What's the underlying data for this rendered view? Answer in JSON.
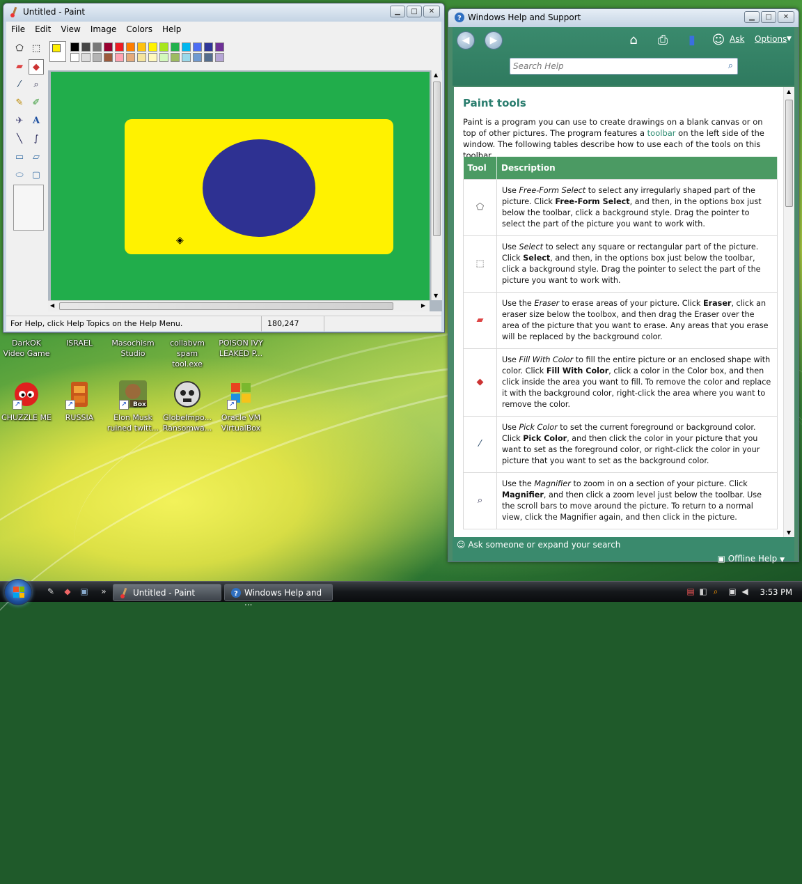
{
  "paint": {
    "title": "Untitled - Paint",
    "menu": [
      "File",
      "Edit",
      "View",
      "Image",
      "Colors",
      "Help"
    ],
    "status_text": "For Help, click Help Topics on the Help Menu.",
    "coordinates": "180,247",
    "foreground_color": "#ffef00",
    "background_color": "#ffffff",
    "palette_top": [
      "#000000",
      "#464646",
      "#787878",
      "#990030",
      "#ed1c24",
      "#ff7e00",
      "#ffc20e",
      "#fff200",
      "#a8e61d",
      "#22b14c",
      "#00b7ef",
      "#4d6df3",
      "#2f3699",
      "#6f3198"
    ],
    "palette_bottom": [
      "#ffffff",
      "#dcdcdc",
      "#b4b4b4",
      "#9c5a3c",
      "#ffa3b1",
      "#e5aa7a",
      "#f5e49c",
      "#fff9bd",
      "#d3f9bc",
      "#9dbb61",
      "#99d9ea",
      "#709ad1",
      "#546d8e",
      "#b5a5d5"
    ],
    "tools": [
      {
        "name": "free-form-select",
        "glyph": "⬠"
      },
      {
        "name": "select",
        "glyph": "⬚"
      },
      {
        "name": "eraser",
        "glyph": "▰"
      },
      {
        "name": "fill-with-color",
        "glyph": "◆"
      },
      {
        "name": "pick-color",
        "glyph": "⁄"
      },
      {
        "name": "magnifier",
        "glyph": "⌕"
      },
      {
        "name": "pencil",
        "glyph": "✎"
      },
      {
        "name": "brush",
        "glyph": "✐"
      },
      {
        "name": "airbrush",
        "glyph": "✈"
      },
      {
        "name": "text",
        "glyph": "A"
      },
      {
        "name": "line",
        "glyph": "╲"
      },
      {
        "name": "curve",
        "glyph": "∫"
      },
      {
        "name": "rectangle",
        "glyph": "▭"
      },
      {
        "name": "polygon",
        "glyph": "▱"
      },
      {
        "name": "ellipse",
        "glyph": "⬭"
      },
      {
        "name": "rounded-rectangle",
        "glyph": "▢"
      }
    ],
    "canvas_colors": {
      "background": "#21ad4b",
      "rectangle": "#fff200",
      "ellipse": "#2e3192"
    }
  },
  "desktop_icons": [
    {
      "label": "DarkOK Video Game"
    },
    {
      "label": "ISRAEL"
    },
    {
      "label": "Masochism Studio"
    },
    {
      "label": "collabvm spam tool.exe"
    },
    {
      "label": "POISON IVY LEAKED P..."
    },
    {
      "label": "CHUZZLE ME"
    },
    {
      "label": "RUSSIA"
    },
    {
      "label": "Elon Musk ruined twitt..."
    },
    {
      "label": "GlobeImpo... Ransomwa..."
    },
    {
      "label": "Oracle VM VirtualBox"
    }
  ],
  "help": {
    "title": "Windows Help and Support",
    "ask_label": "Ask",
    "options_label": "Options",
    "search_placeholder": "Search Help",
    "page_title": "Paint tools",
    "intro_1": "Paint is a program you can use to create drawings on a blank canvas or on top of other pictures. The program features a ",
    "intro_link": "toolbar",
    "intro_2": " on the left side of the window. The following tables describe how to use each of the tools on this toolbar.",
    "table_headers": [
      "Tool",
      "Description"
    ],
    "rows": [
      {
        "icon": "free-form-select-icon",
        "glyph": "⬠",
        "pre": "Use ",
        "em": "Free-Form Select",
        "mid": " to select any irregularly shaped part of the picture. Click ",
        "b": "Free-Form Select",
        "post": ", and then, in the options box just below the toolbar, click a background style. Drag the pointer to select the part of the picture you want to work with."
      },
      {
        "icon": "select-icon",
        "glyph": "⬚",
        "pre": "Use ",
        "em": "Select",
        "mid": " to select any square or rectangular part of the picture. Click ",
        "b": "Select",
        "post": ", and then, in the options box just below the toolbar, click a background style. Drag the pointer to select the part of the picture you want to work with."
      },
      {
        "icon": "eraser-icon",
        "glyph": "▰",
        "pre": "Use the ",
        "em": "Eraser",
        "mid": " to erase areas of your picture. Click ",
        "b": "Eraser",
        "post": ", click an eraser size below the toolbox, and then drag the Eraser over the area of the picture that you want to erase. Any areas that you erase will be replaced by the background color."
      },
      {
        "icon": "fill-with-color-icon",
        "glyph": "◆",
        "pre": "Use ",
        "em": "Fill With Color",
        "mid": " to fill the entire picture or an enclosed shape with color. Click ",
        "b": "Fill With Color",
        "post": ", click a color in the Color box, and then click inside the area you want to fill. To remove the color and replace it with the background color, right-click the area where you want to remove the color."
      },
      {
        "icon": "pick-color-icon",
        "glyph": "⁄",
        "pre": "Use ",
        "em": "Pick Color",
        "mid": " to set the current foreground or background color. Click ",
        "b": "Pick Color",
        "post": ", and then click the color in your picture that you want to set as the foreground color, or right-click the color in your picture that you want to set as the background color."
      },
      {
        "icon": "magnifier-icon",
        "glyph": "⌕",
        "pre": "Use the ",
        "em": "Magnifier",
        "mid": " to zoom in on a section of your picture. Click ",
        "b": "Magnifier",
        "post": ", and then click a zoom level just below the toolbar. Use the scroll bars to move around the picture. To return to a normal view, click the Magnifier again, and then click in the picture."
      }
    ],
    "footer_ask": "Ask someone or expand your search",
    "footer_offline": "Offline Help"
  },
  "taskbar": {
    "buttons": [
      {
        "label": "Untitled - Paint"
      },
      {
        "label": "Windows Help and ..."
      }
    ],
    "clock": "3:53 PM"
  }
}
